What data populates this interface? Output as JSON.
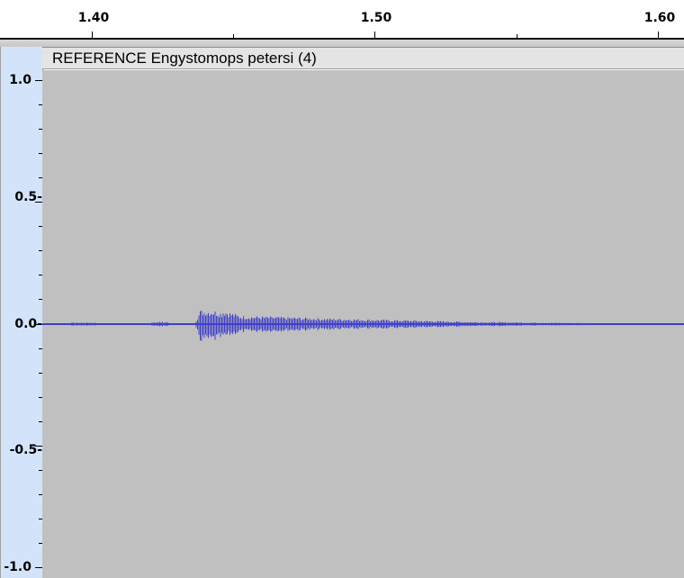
{
  "timeline": {
    "labels": [
      "1.40",
      "1.50",
      "1.60"
    ]
  },
  "track": {
    "name": "REFERENCE Engystomops petersi (4)"
  },
  "amplitude_ruler": {
    "labels": [
      "1.0",
      "0.5-",
      "0.0-",
      "-0.5-",
      "-1.0"
    ]
  },
  "colors": {
    "waveform": "#3f3fc8",
    "waveform_background": "#c0c0c0",
    "ruler_background": "#d3e4fa"
  }
}
